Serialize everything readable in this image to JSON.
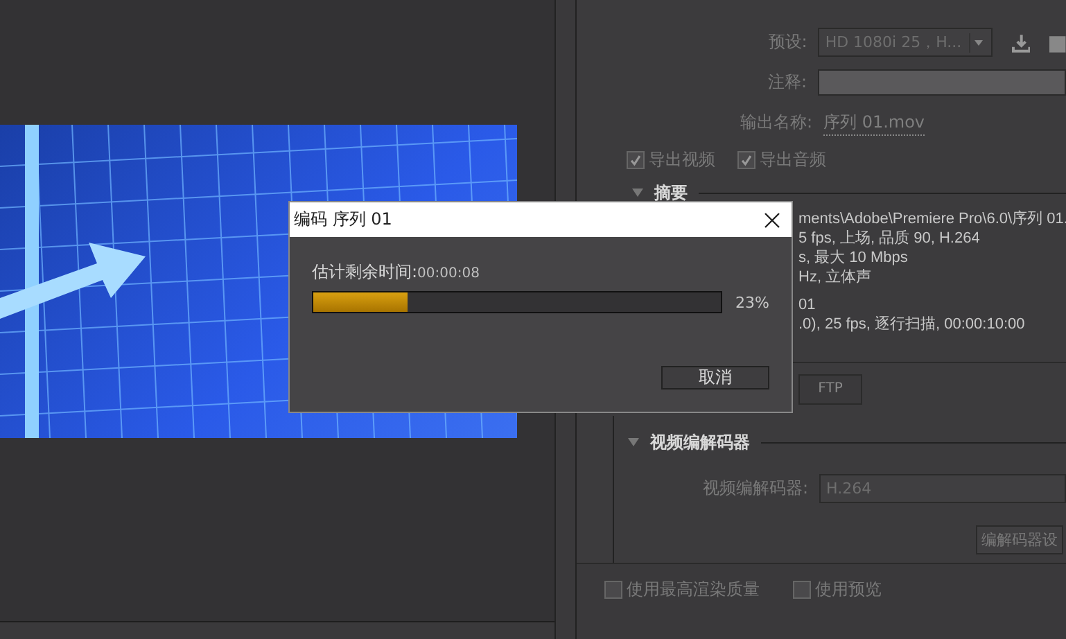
{
  "settings": {
    "preset": {
      "label": "预设:",
      "value": "HD 1080i 25，H..."
    },
    "comment": {
      "label": "注释:"
    },
    "output_name": {
      "label": "输出名称:",
      "value": "序列 01.mov"
    },
    "exports": [
      {
        "label": "导出视频",
        "checked": true
      },
      {
        "label": "导出音频",
        "checked": true
      }
    ],
    "summary": {
      "title": "摘要",
      "expanded": true,
      "lines": [
        "ments\\Adobe\\Premiere Pro\\6.0\\序列 01.",
        "5 fps, 上场, 品质 90, H.264",
        "s, 最大 10 Mbps",
        "Hz, 立体声",
        "01",
        ".0), 25 fps, 逐行扫描, 00:00:10:00"
      ]
    },
    "tabs": [
      {
        "label": "FTP",
        "selected": false
      }
    ],
    "codec_section": {
      "title": "视频编解码器",
      "expanded": true,
      "label": "视频编解码器:",
      "value": "H.264",
      "button": "编解码器设"
    },
    "options": [
      {
        "label": "使用最高渲染质量",
        "checked": false
      },
      {
        "label": "使用预览",
        "checked": false
      }
    ]
  },
  "dialog": {
    "title": "编码 序列 01",
    "time_label": "估计剩余时间:",
    "time": "00:00:08",
    "progress": {
      "level": 0.23,
      "reading": "23%"
    },
    "cancel": "取消"
  }
}
